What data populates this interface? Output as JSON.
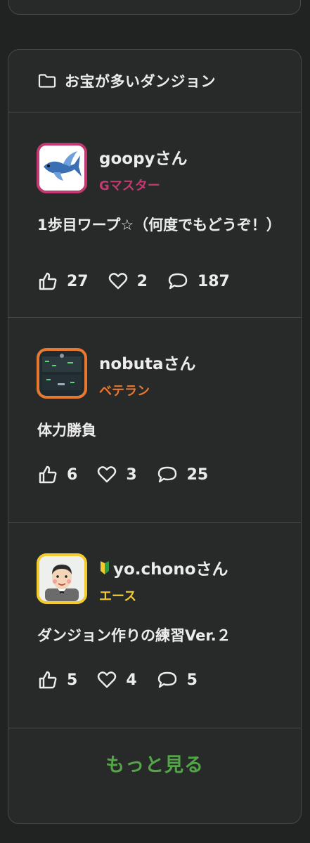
{
  "section": {
    "title": "お宝が多いダンジョン",
    "icon": "folder-icon"
  },
  "items": [
    {
      "user": "goopyさん",
      "rank": "Gマスター",
      "rank_color": "#c23a71",
      "title": "1歩目ワープ☆（何度でもどうぞ！）",
      "likes": "27",
      "hearts": "2",
      "comments": "187"
    },
    {
      "user": "nobutaさん",
      "rank": "ベテラン",
      "rank_color": "#e8782f",
      "title": "体力勝負",
      "likes": "6",
      "hearts": "3",
      "comments": "25"
    },
    {
      "user": "yo.chonoさん",
      "rank": "エース",
      "rank_color": "#f2cb2f",
      "title": "ダンジョン作りの練習Ver.２",
      "likes": "5",
      "hearts": "4",
      "comments": "5"
    }
  ],
  "more_label": "もっと見る"
}
